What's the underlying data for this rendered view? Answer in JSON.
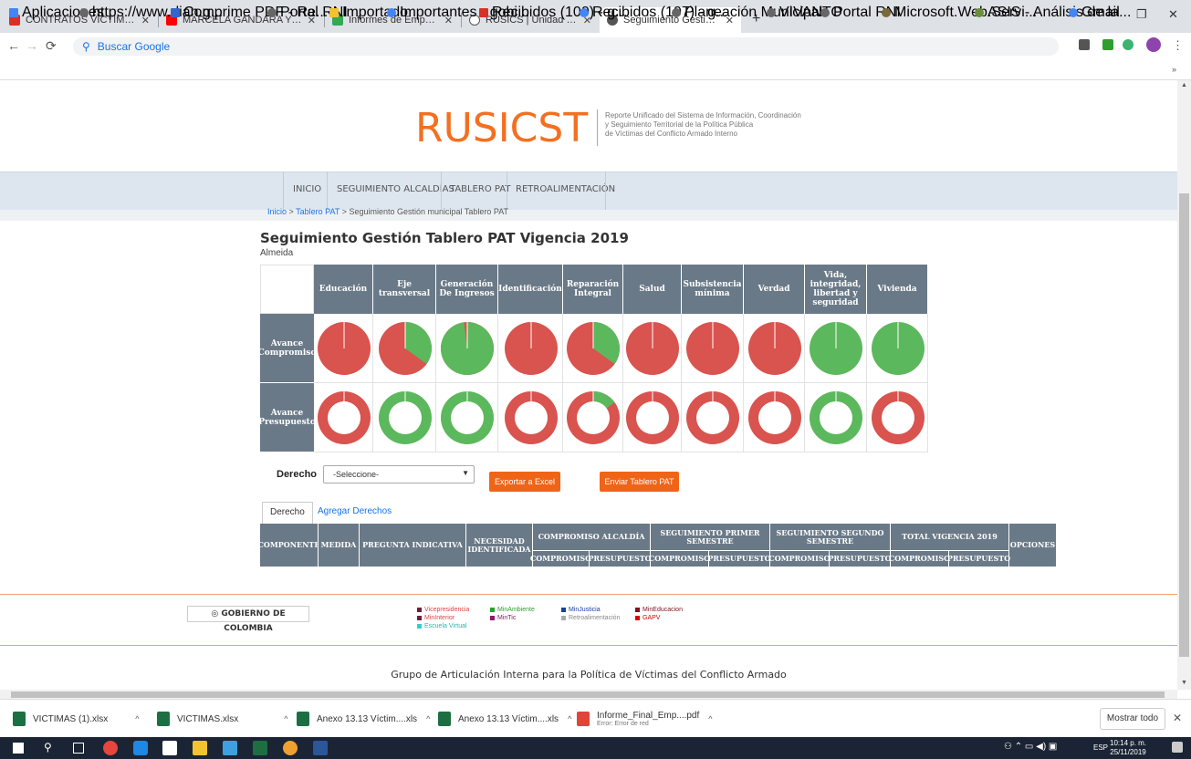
{
  "browser": {
    "tabs": [
      {
        "title": "CONTRATOS VICTIMAS - gobiern",
        "color": "#d93025"
      },
      {
        "title": "MARCELA GÁNDARA Y JESÚ",
        "color": "#ff0000"
      },
      {
        "title": "Informes de Empalme",
        "color": "#34a853"
      },
      {
        "title": "RUSICS | Unidad para las Víctima",
        "color": "#555555"
      },
      {
        "title": "Seguimiento Gestión municipal T",
        "color": "#555555"
      }
    ],
    "omnibox": "Buscar Google",
    "bookmarks": [
      "Aplicaciones",
      "https://www.dian.g...",
      "Comprime PDF - Re...",
      "Portal RNI",
      "Importado",
      "Importantes - gobi...",
      "Recibidos (100) - g...",
      "Recibidos (107) - g...",
      "Planeación Municipal",
      "VIVANTO",
      "Portal RNI",
      "Microsoft.Web.Servi...",
      "ASIS - Análisis de la...",
      "Gmail"
    ]
  },
  "header": {
    "logo": "RUSICST",
    "subtitle_1": "Reporte Unificado del Sistema de Información, Coordinación",
    "subtitle_2": "y Seguimiento Territorial de la Política Pública",
    "subtitle_3": "de Víctimas del Conflicto Armado Interno"
  },
  "nav": {
    "items": [
      "INICIO",
      "SEGUIMIENTO ALCALDÍAS",
      "TABLERO PAT",
      "RETROALIMENTACIÓN"
    ]
  },
  "breadcrumb": {
    "inicio": "Inicio",
    "sep": ">",
    "tablero": "Tablero PAT",
    "current": "Seguimiento Gestión municipal Tablero PAT"
  },
  "page": {
    "title": "Seguimiento Gestión Tablero PAT Vigencia 2019",
    "municipio": "Almeida"
  },
  "matrix": {
    "columns": [
      "Educación",
      "Eje transversal",
      "Generación De Ingresos",
      "Identificación",
      "Reparación Integral",
      "Salud",
      "Subsistencia mínima",
      "Verdad",
      "Vida, integridad, libertad y seguridad",
      "Vivienda"
    ],
    "rows": [
      "Avance Compromiso",
      "Avance Presupuesto"
    ],
    "compromiso_pct": [
      0,
      35,
      98,
      0,
      35,
      0,
      0,
      0,
      100,
      100
    ],
    "presupuesto_pct": [
      0,
      100,
      100,
      0,
      15,
      0,
      0,
      0,
      100,
      0
    ],
    "colors": {
      "done": "#5cb85c",
      "pending": "#d9534f"
    }
  },
  "controls": {
    "derecho_label": "Derecho",
    "select_value": "-Seleccione-",
    "export_button": "Exportar a Excel",
    "send_button": "Enviar Tablero PAT"
  },
  "subtabs": [
    "Derecho",
    "Agregar Derechos"
  ],
  "table": {
    "componente": "COMPONENTE",
    "medida": "MEDIDA",
    "pregunta": "PREGUNTA INDICATIVA",
    "necesidad": "NECESIDAD IDENTIFICADA",
    "compromiso_alcaldia": "COMPROMISO ALCALDÍA",
    "seg_primer": "SEGUIMIENTO PRIMER SEMESTRE",
    "seg_segundo": "SEGUIMIENTO SEGUNDO SEMESTRE",
    "total": "TOTAL VIGENCIA 2019",
    "opciones": "OPCIONES",
    "sub_compromiso": "COMPROMISO",
    "sub_presupuesto": "PRESUPUESTO"
  },
  "footer": {
    "gobierno": "GOBIERNO DE COLOMBIA",
    "links": [
      {
        "label": "Vicepresidencia",
        "color": "#6d1f3a"
      },
      {
        "label": "MinInterior",
        "color": "#6d1f3a"
      },
      {
        "label": "Escuela Virtual",
        "color": "#2bd4c8"
      },
      {
        "label": "MinAmbiente",
        "color": "#2e9e2e"
      },
      {
        "label": "MinTic",
        "color": "#8e1a6b"
      },
      {
        "label": "MinJusticia",
        "color": "#1c3f9e"
      },
      {
        "label": "Retroalimentación",
        "color": "#aaaaaa"
      },
      {
        "label": "MinEducacion",
        "color": "#7a1420"
      },
      {
        "label": "GAPV",
        "color": "#e00000"
      }
    ],
    "bottom_text": "Grupo de Articulación Interna para la Política de Víctimas del Conflicto Armado"
  },
  "downloads": {
    "items": [
      {
        "name": "VICTIMAS (1).xlsx",
        "sub": ""
      },
      {
        "name": "VICTIMAS.xlsx",
        "sub": ""
      },
      {
        "name": "Anexo 13.13 Víctim....xls",
        "sub": ""
      },
      {
        "name": "Anexo 13.13 Víctim....xls",
        "sub": ""
      },
      {
        "name": "Informe_Final_Emp....pdf",
        "sub": "Error: Error de red"
      }
    ],
    "show_all": "Mostrar todo"
  },
  "taskbar": {
    "time": "10:14 p. m.",
    "date": "25/11/2019",
    "lang": "ESP"
  }
}
